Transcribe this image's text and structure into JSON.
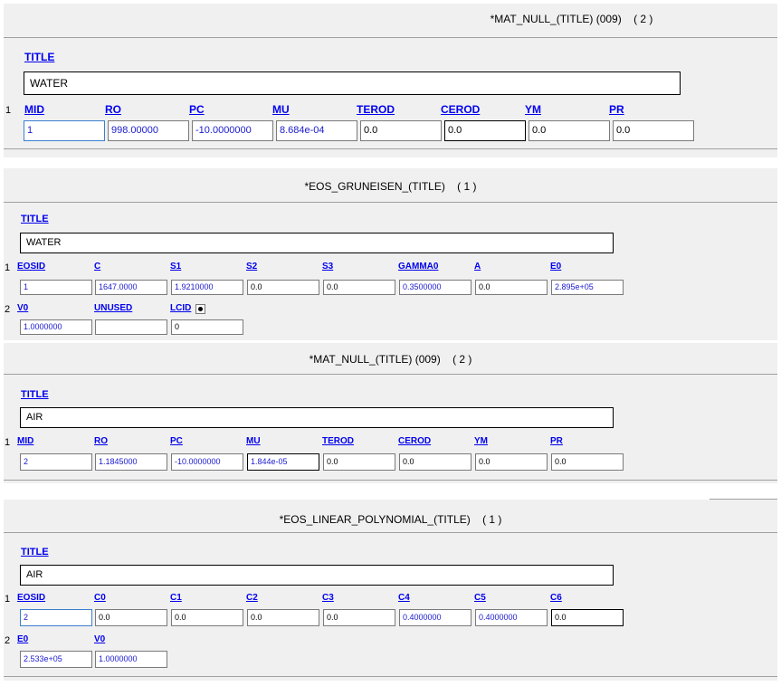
{
  "panels": [
    {
      "header": "*MAT_NULL_(TITLE) (009)    ( 2 )",
      "title_label": "TITLE",
      "title_value": "WATER",
      "row1": {
        "num": "1",
        "labels": [
          "MID",
          "RO",
          "PC",
          "MU",
          "TEROD",
          "CEROD",
          "YM",
          "PR"
        ],
        "values": [
          "1",
          "998.00000",
          "-10.0000000",
          "8.684e-04",
          "0.0",
          "0.0",
          "0.0",
          "0.0"
        ]
      }
    },
    {
      "header": "*EOS_GRUNEISEN_(TITLE)    ( 1 )",
      "title_label": "TITLE",
      "title_value": "WATER",
      "row1": {
        "num": "1",
        "labels": [
          "EOSID",
          "C",
          "S1",
          "S2",
          "S3",
          "GAMMA0",
          "A",
          "E0"
        ],
        "values": [
          "1",
          "1647.0000",
          "1.9210000",
          "0.0",
          "0.0",
          "0.3500000",
          "0.0",
          "2.895e+05"
        ]
      },
      "row2": {
        "num": "2",
        "labels": [
          "V0",
          "UNUSED",
          "LCID"
        ],
        "values": [
          "1.0000000",
          "",
          "0"
        ]
      }
    },
    {
      "header": "*MAT_NULL_(TITLE) (009)    ( 2 )",
      "title_label": "TITLE",
      "title_value": "AIR",
      "row1": {
        "num": "1",
        "labels": [
          "MID",
          "RO",
          "PC",
          "MU",
          "TEROD",
          "CEROD",
          "YM",
          "PR"
        ],
        "values": [
          "2",
          "1.1845000",
          "-10.0000000",
          "1.844e-05",
          "0.0",
          "0.0",
          "0.0",
          "0.0"
        ]
      }
    },
    {
      "header": "*EOS_LINEAR_POLYNOMIAL_(TITLE)    ( 1 )",
      "title_label": "TITLE",
      "title_value": "AIR",
      "row1": {
        "num": "1",
        "labels": [
          "EOSID",
          "C0",
          "C1",
          "C2",
          "C3",
          "C4",
          "C5",
          "C6"
        ],
        "values": [
          "2",
          "0.0",
          "0.0",
          "0.0",
          "0.0",
          "0.4000000",
          "0.4000000",
          "0.0"
        ]
      },
      "row2": {
        "num": "2",
        "labels": [
          "E0",
          "V0"
        ],
        "values": [
          "2.533e+05",
          "1.0000000"
        ]
      }
    }
  ]
}
